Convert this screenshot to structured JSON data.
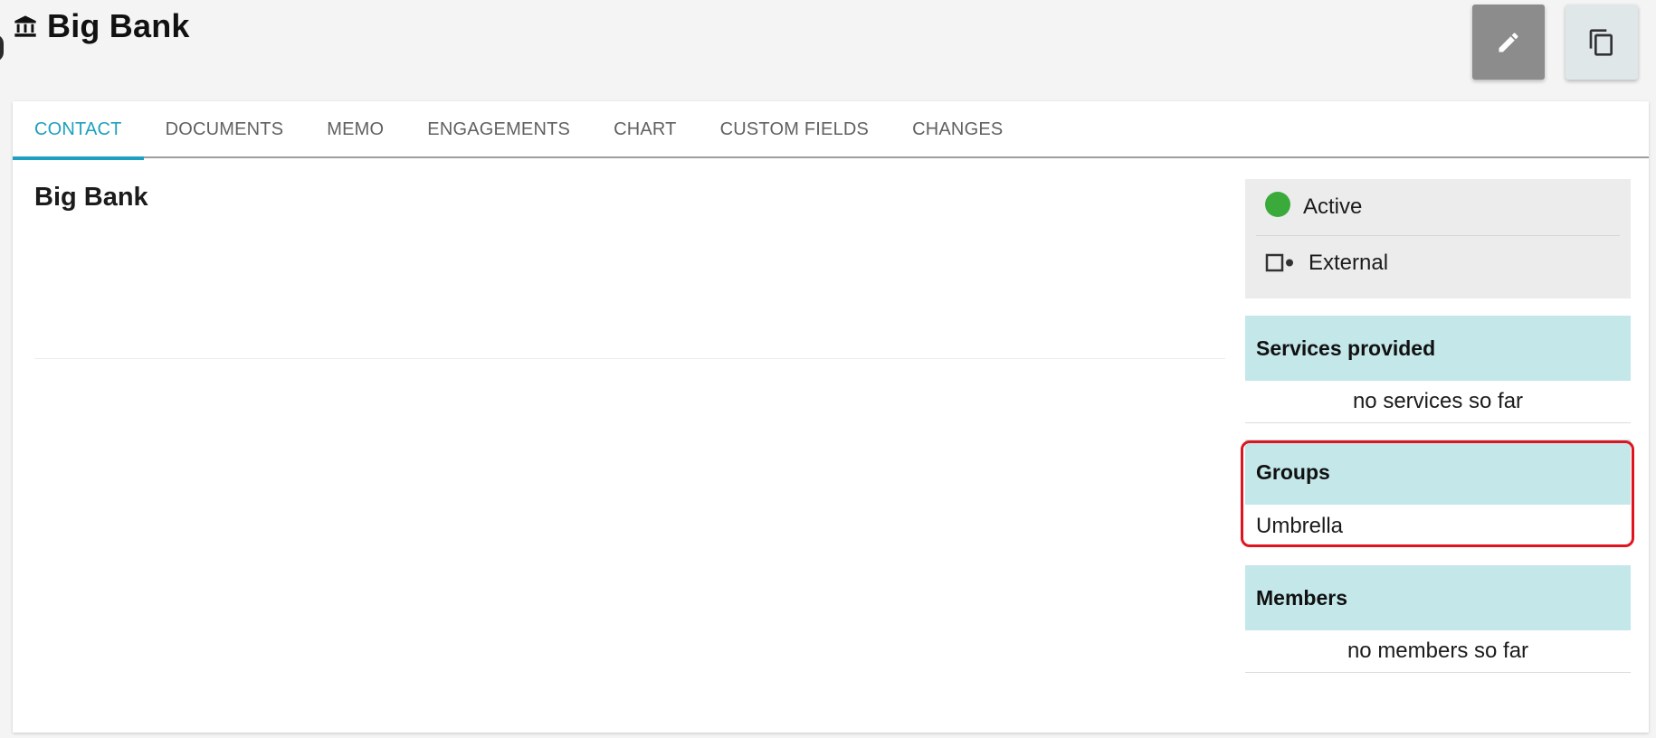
{
  "header": {
    "title": "Big Bank",
    "icons": {
      "title": "bank-icon",
      "edit": "pencil-icon",
      "copy": "copy-icon"
    }
  },
  "tabs": [
    {
      "label": "CONTACT",
      "active": true
    },
    {
      "label": "DOCUMENTS",
      "active": false
    },
    {
      "label": "MEMO",
      "active": false
    },
    {
      "label": "ENGAGEMENTS",
      "active": false
    },
    {
      "label": "CHART",
      "active": false
    },
    {
      "label": "CUSTOM FIELDS",
      "active": false
    },
    {
      "label": "CHANGES",
      "active": false
    }
  ],
  "main": {
    "name": "Big Bank"
  },
  "status": {
    "active_label": "Active",
    "external_label": "External"
  },
  "services": {
    "title": "Services provided",
    "empty_text": "no services so far"
  },
  "groups": {
    "title": "Groups",
    "items": [
      "Umbrella"
    ]
  },
  "members": {
    "title": "Members",
    "empty_text": "no members so far"
  },
  "colors": {
    "accent": "#1ea0c0",
    "active_dot": "#3aaa3a",
    "panel_header": "#c4e7ea",
    "highlight": "#e0141e"
  }
}
